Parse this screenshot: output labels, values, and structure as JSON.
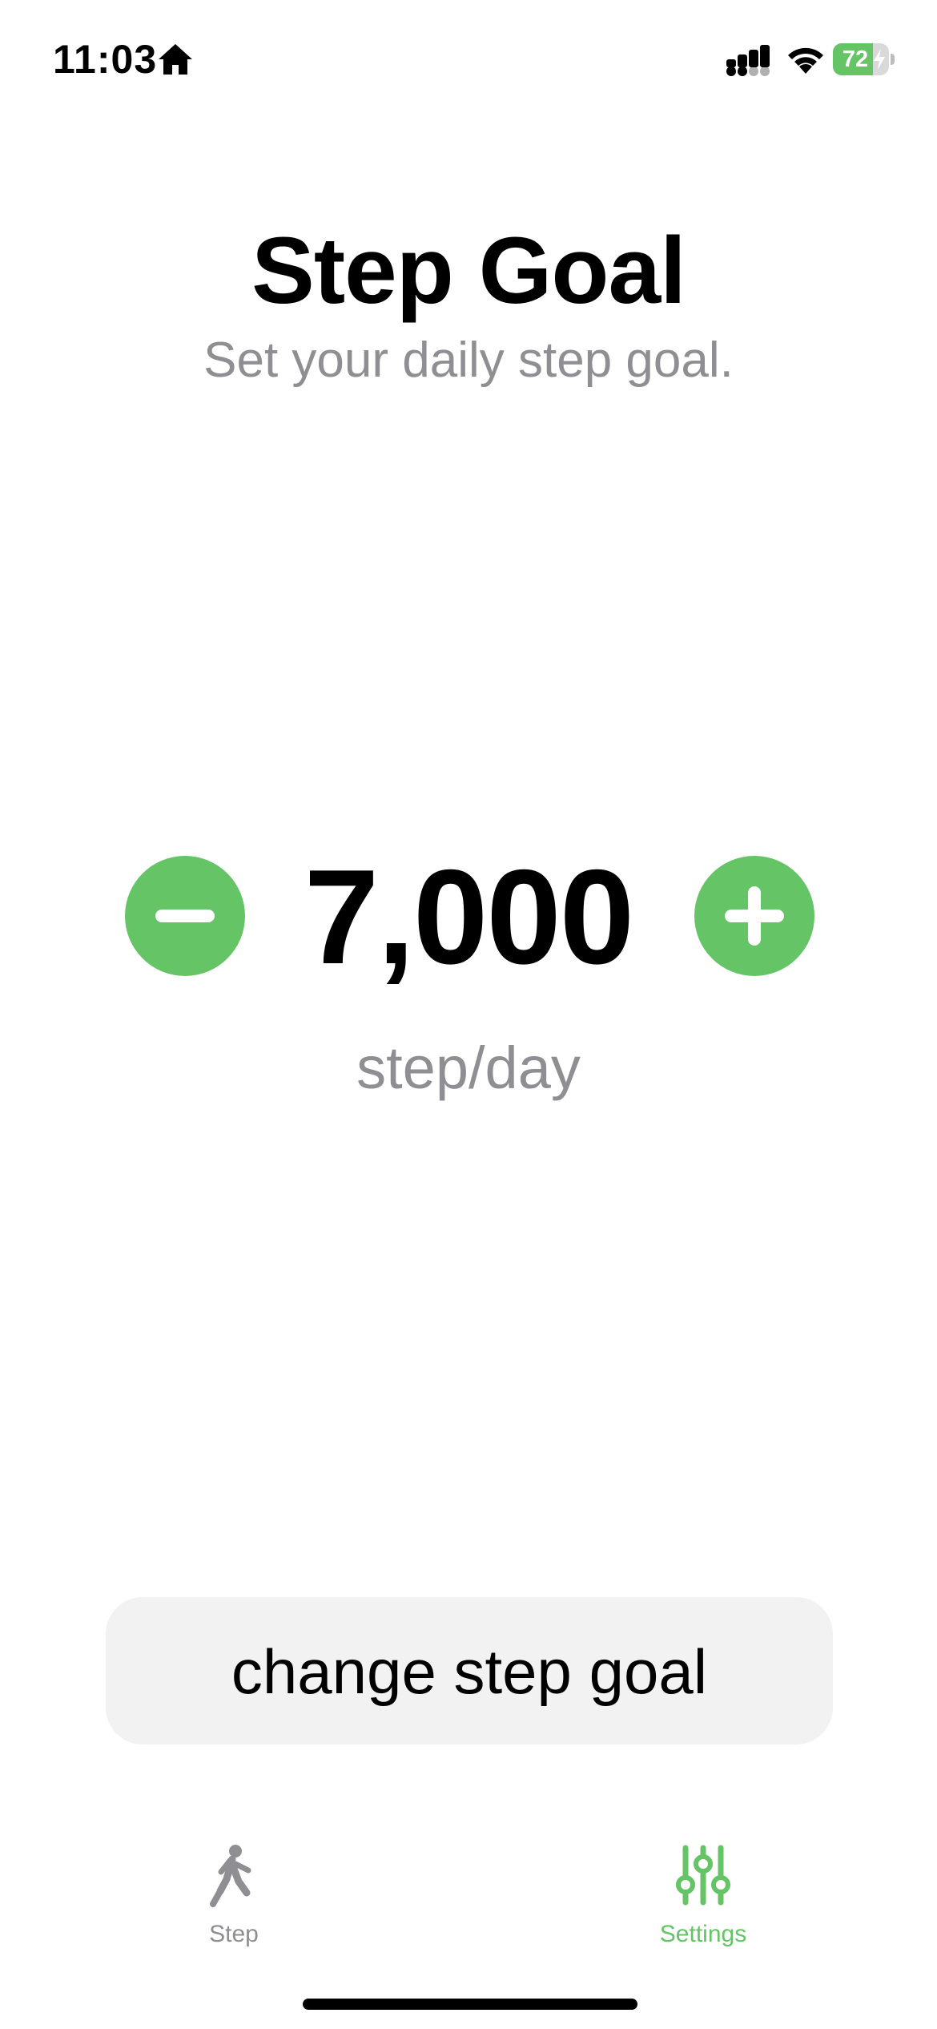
{
  "status_bar": {
    "time": "11:03",
    "battery_level": "72",
    "battery_fraction": 0.72,
    "icons": [
      "home-icon",
      "signal-icon",
      "wifi-icon",
      "charging-bolt-icon"
    ]
  },
  "header": {
    "title": "Step Goal",
    "subtitle": "Set your daily step goal."
  },
  "goal": {
    "value": "7,000",
    "unit": "step/day",
    "decrement_icon": "minus-icon",
    "increment_icon": "plus-icon"
  },
  "actions": {
    "change_label": "change step goal"
  },
  "tab_bar": {
    "items": [
      {
        "label": "Step",
        "icon": "walking-figure-icon",
        "selected": false
      },
      {
        "label": "Settings",
        "icon": "sliders-icon",
        "selected": true
      }
    ]
  },
  "colors": {
    "accent": "#64c466",
    "secondary_text": "#8e8e93",
    "button_background": "#f2f2f2"
  }
}
